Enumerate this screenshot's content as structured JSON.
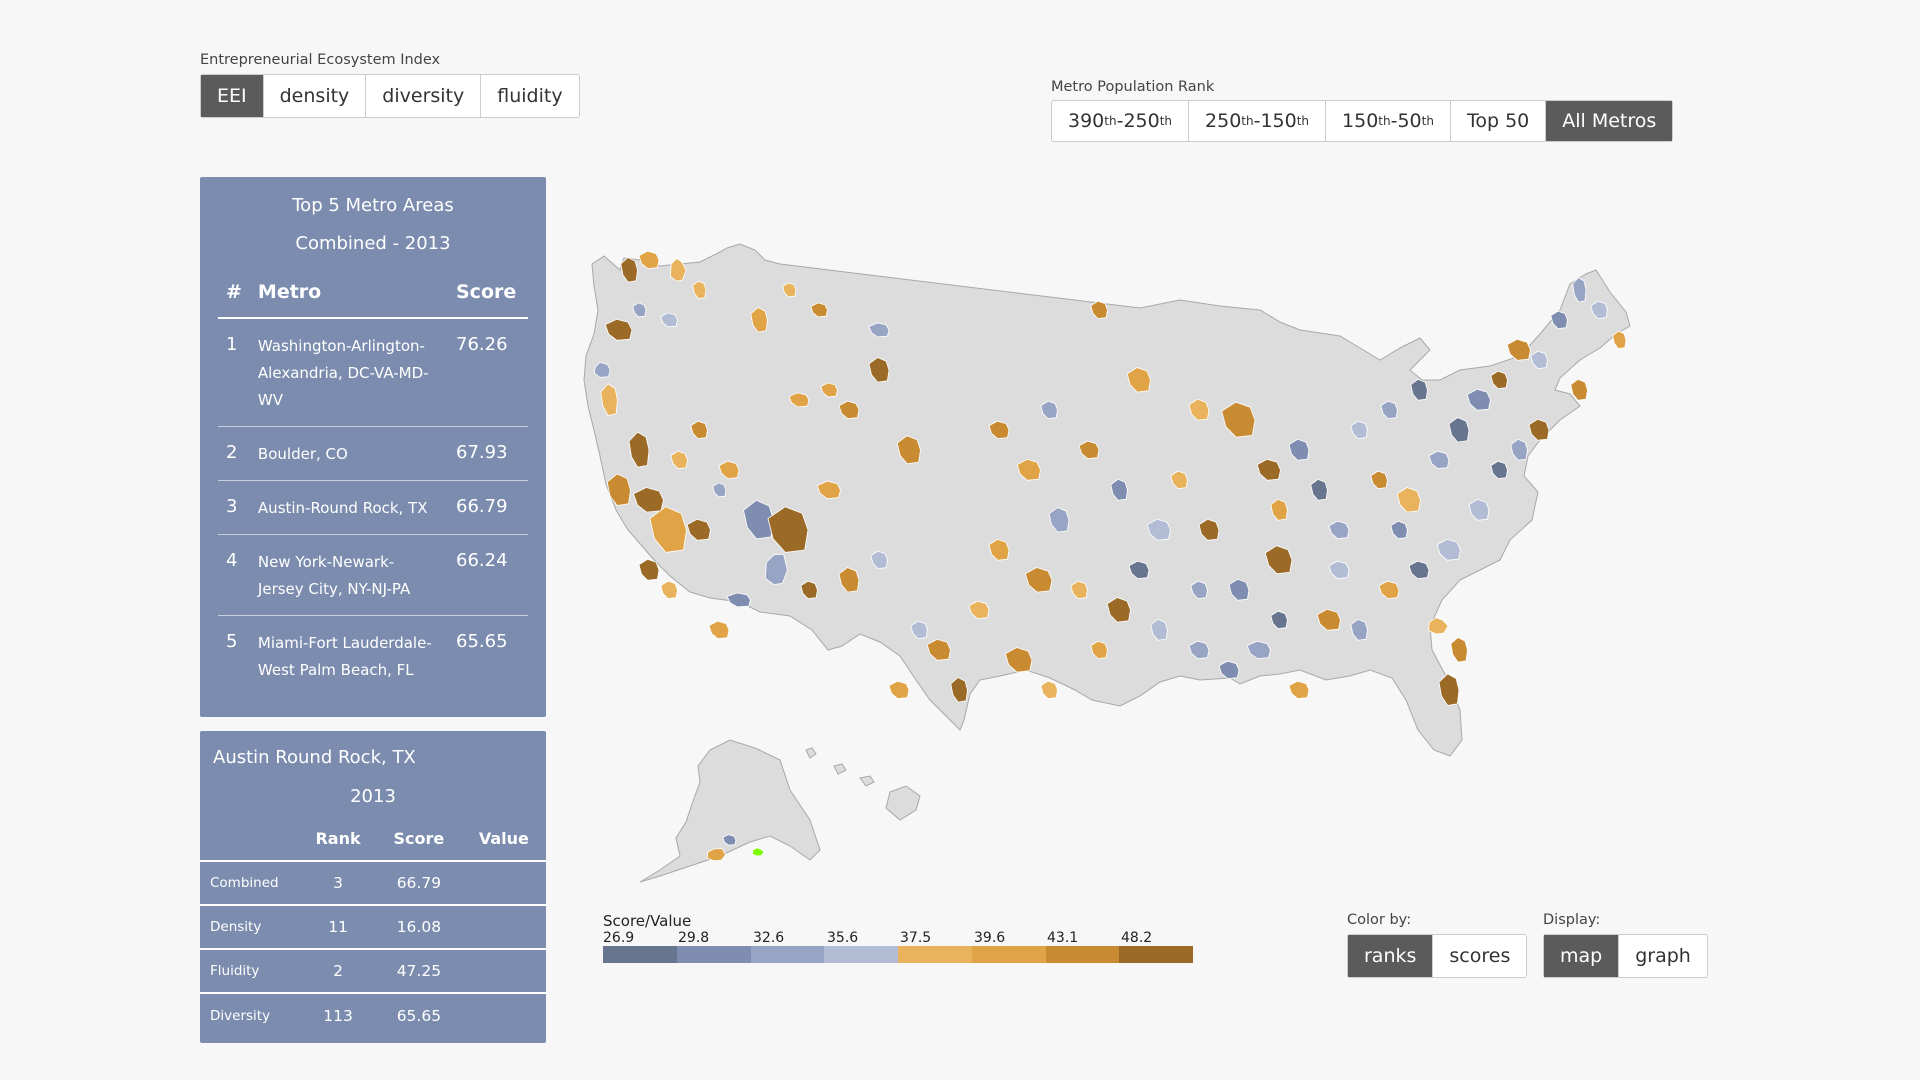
{
  "index_selector": {
    "caption": "Entrepreneurial Ecosystem Index",
    "tabs": [
      {
        "label": "EEI",
        "active": true
      },
      {
        "label": "density",
        "active": false
      },
      {
        "label": "diversity",
        "active": false
      },
      {
        "label": "fluidity",
        "active": false
      }
    ]
  },
  "population_rank": {
    "caption": "Metro Population Rank",
    "options": [
      {
        "a": "390",
        "a_sup": "th",
        "mid": " - ",
        "b": "250",
        "b_sup": "th",
        "active": false
      },
      {
        "a": "250",
        "a_sup": "th",
        "mid": " - ",
        "b": "150",
        "b_sup": "th",
        "active": false
      },
      {
        "a": "150",
        "a_sup": "th",
        "mid": " - ",
        "b": "50",
        "b_sup": "th",
        "active": false
      },
      {
        "a": "Top 50",
        "a_sup": "",
        "mid": "",
        "b": "",
        "b_sup": "",
        "active": false
      },
      {
        "a": "All Metros",
        "a_sup": "",
        "mid": "",
        "b": "",
        "b_sup": "",
        "active": true
      }
    ]
  },
  "top5": {
    "title": "Top 5 Metro Areas",
    "subtitle": "Combined - 2013",
    "headers": {
      "rank": "#",
      "metro": "Metro",
      "score": "Score"
    },
    "rows": [
      {
        "rank": "1",
        "metro": "Washington-Arlington-Alexandria, DC-VA-MD-WV",
        "score": "76.26"
      },
      {
        "rank": "2",
        "metro": "Boulder, CO",
        "score": "67.93"
      },
      {
        "rank": "3",
        "metro": "Austin-Round Rock, TX",
        "score": "66.79"
      },
      {
        "rank": "4",
        "metro": "New York-Newark-Jersey City, NY-NJ-PA",
        "score": "66.24"
      },
      {
        "rank": "5",
        "metro": "Miami-Fort Lauderdale-West Palm Beach, FL",
        "score": "65.65"
      }
    ]
  },
  "detail": {
    "title": "Austin Round Rock, TX",
    "year": "2013",
    "headers": {
      "rank": "Rank",
      "score": "Score",
      "value": "Value"
    },
    "rows": [
      {
        "label": "Combined",
        "rank": "3",
        "score": "66.79",
        "value": ""
      },
      {
        "label": "Density",
        "rank": "11",
        "score": "16.08",
        "value": ""
      },
      {
        "label": "Fluidity",
        "rank": "2",
        "score": "47.25",
        "value": ""
      },
      {
        "label": "Diversity",
        "rank": "113",
        "score": "65.65",
        "value": ""
      }
    ]
  },
  "legend": {
    "title": "Score/Value",
    "ticks": [
      "26.9",
      "29.8",
      "32.6",
      "35.6",
      "37.5",
      "39.6",
      "43.1",
      "48.2"
    ],
    "colors": [
      "#68758f",
      "#7e8db0",
      "#97a4c3",
      "#b2bdd5",
      "#e8b35c",
      "#e0a446",
      "#c98b32",
      "#9a6a26"
    ]
  },
  "color_by": {
    "caption": "Color by:",
    "options": [
      {
        "label": "ranks",
        "active": true
      },
      {
        "label": "scores",
        "active": false
      }
    ]
  },
  "display": {
    "caption": "Display:",
    "options": [
      {
        "label": "map",
        "active": true
      },
      {
        "label": "graph",
        "active": false
      }
    ]
  },
  "map": {
    "land_color": "#dcdcdc",
    "border_color": "#a8a8a8",
    "highlight_color": "#7cfc00"
  }
}
